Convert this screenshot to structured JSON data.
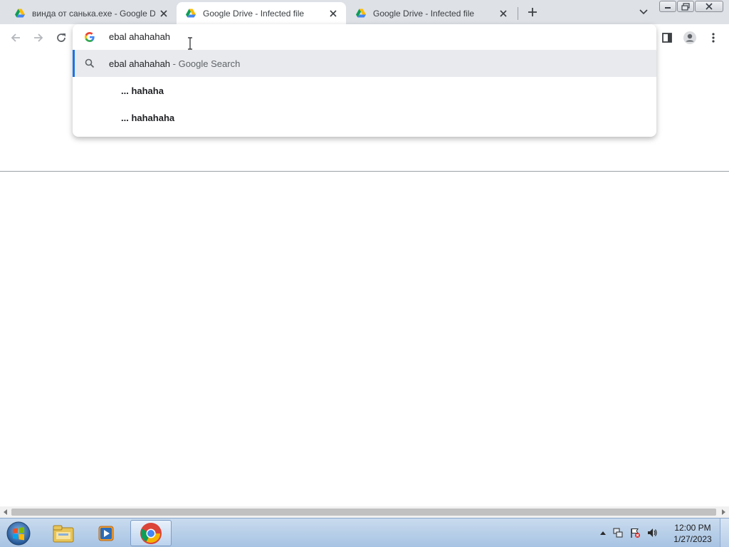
{
  "browser": {
    "tabs": [
      {
        "title": "винда от санька.exe - Google Drive",
        "active": false,
        "icon": "google-drive-icon"
      },
      {
        "title": "Google Drive - Infected file",
        "active": true,
        "icon": "google-drive-icon"
      },
      {
        "title": "Google Drive - Infected file",
        "active": false,
        "icon": "google-drive-icon"
      }
    ]
  },
  "omnibox": {
    "input_value": "ebal ahahahah",
    "suggestions": [
      {
        "main": "ebal ahahahah",
        "sub": " - Google Search",
        "icon": "search-icon",
        "selected": true
      },
      {
        "main": "... hahaha",
        "icon": "none",
        "selected": false
      },
      {
        "main": "... hahahaha",
        "icon": "none",
        "selected": false
      }
    ]
  },
  "taskbar": {
    "clock_time": "12:00 PM",
    "clock_date": "1/27/2023",
    "apps": [
      "windows-explorer-icon",
      "media-player-icon",
      "chrome-icon"
    ]
  },
  "colors": {
    "accent": "#1a73e8",
    "tabstrip": "#dee1e6",
    "taskbar": "#b9d0ec"
  }
}
